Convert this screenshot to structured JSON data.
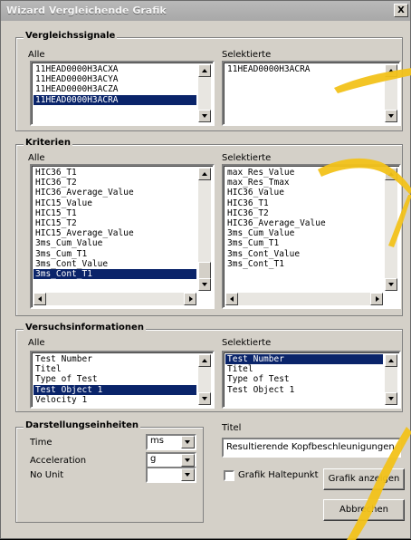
{
  "window": {
    "title": "Wizard Vergleichende Grafik",
    "close_label": "X"
  },
  "vergleich": {
    "title": "Vergleichssignale",
    "alle_label": "Alle",
    "sel_label": "Selektierte",
    "alle_items": [
      "11HEAD0000H3ACXA",
      "11HEAD0000H3ACYA",
      "11HEAD0000H3ACZA",
      "11HEAD0000H3ACRA"
    ],
    "alle_selected_index": 3,
    "sel_items": [
      "11HEAD0000H3ACRA"
    ]
  },
  "kriterien": {
    "title": "Kriterien",
    "alle_label": "Alle",
    "sel_label": "Selektierte",
    "alle_items": [
      "HIC36_T1",
      "HIC36_T2",
      "HIC36_Average_Value",
      "HIC15_Value",
      "HIC15_T1",
      "HIC15_T2",
      "HIC15_Average_Value",
      "3ms_Cum_Value",
      "3ms_Cum_T1",
      "3ms_Cont_Value",
      "3ms_Cont_T1"
    ],
    "alle_selected_index": 10,
    "sel_items": [
      "max_Res_Value",
      "max_Res_Tmax",
      "HIC36_Value",
      "HIC36_T1",
      "HIC36_T2",
      "HIC36_Average_Value",
      "3ms_Cum_Value",
      "3ms_Cum_T1",
      "3ms_Cont_Value",
      "3ms_Cont_T1"
    ],
    "alle_scroll_fraction": 0.85
  },
  "versuch": {
    "title": "Versuchsinformationen",
    "alle_label": "Alle",
    "sel_label": "Selektierte",
    "alle_items": [
      "Test Number",
      "Titel",
      "Type of Test",
      "Test Object 1",
      "Velocity 1"
    ],
    "alle_selected_index": 3,
    "sel_items": [
      "Test Number",
      "Titel",
      "Type of Test",
      "Test Object 1"
    ],
    "sel_selected_index": 0
  },
  "darstellung": {
    "title": "Darstellungseinheiten",
    "rows": [
      {
        "label": "Time",
        "value": "ms"
      },
      {
        "label": "Acceleration",
        "value": "g"
      },
      {
        "label": "No Unit",
        "value": ""
      }
    ]
  },
  "titel": {
    "label": "Titel",
    "value": "Resultierende Kopfbeschleunigungen"
  },
  "grafik_haltepunkt": {
    "label": "Grafik Haltepunkt",
    "checked": false
  },
  "buttons": {
    "show": "Grafik anzeigen",
    "cancel": "Abbrechen"
  },
  "colors": {
    "selection": "#0a246a",
    "dialog": "#d4d0c8",
    "highlighter": "#f2c21a"
  }
}
